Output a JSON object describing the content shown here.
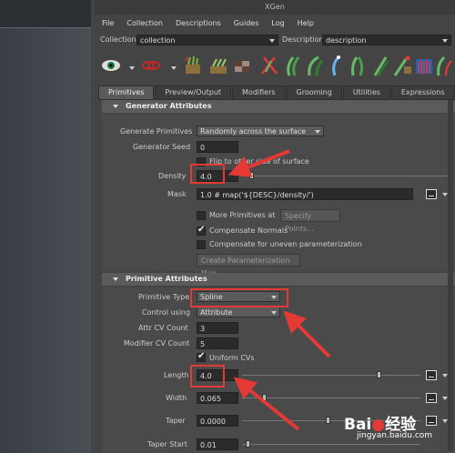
{
  "window": {
    "title": "XGen"
  },
  "menubar": [
    "File",
    "Collection",
    "Descriptions",
    "Guides",
    "Log",
    "Help"
  ],
  "collection_row": {
    "collection_label": "Collection",
    "collection_value": "collection",
    "description_label": "Description",
    "description_value": "description"
  },
  "tabs": [
    "Primitives",
    "Preview/Output",
    "Modifiers",
    "Grooming",
    "Utilities",
    "Expressions"
  ],
  "active_tab": "Primitives",
  "generator": {
    "header": "Generator Attributes",
    "generate_primitives_label": "Generate Primitives",
    "generate_primitives_value": "Randomly across the surface",
    "generator_seed_label": "Generator Seed",
    "generator_seed_value": "0",
    "flip_label": "Flip to other side of surface",
    "density_label": "Density",
    "density_value": "4.0",
    "mask_label": "Mask",
    "mask_value": "1.0 # map('${DESC}/density/')",
    "more_primitives_label": "More Primitives at",
    "specify_points_button": "Specify Points...",
    "compensate_normals_label": "Compensate Normals",
    "compensate_uneven_label": "Compensate for uneven parameterization",
    "create_map_button": "Create Parameterization Map"
  },
  "primitive": {
    "header": "Primitive Attributes",
    "primitive_type_label": "Primitive Type",
    "primitive_type_value": "Spline",
    "control_using_label": "Control using",
    "control_using_value": "Attribute",
    "attr_cv_count_label": "Attr CV Count",
    "attr_cv_count_value": "3",
    "modifier_cv_count_label": "Modifier CV Count",
    "modifier_cv_count_value": "5",
    "uniform_cvs_label": "Uniform CVs",
    "length_label": "Length",
    "length_value": "4.0",
    "width_label": "Width",
    "width_value": "0.065",
    "taper_label": "Taper",
    "taper_value": "0.0000",
    "taper_start_label": "Taper Start",
    "taper_start_value": "0.01"
  },
  "watermark": {
    "brand": "Bai",
    "brand2": "经验",
    "url": "jingyan.baidu.com"
  },
  "colors": {
    "highlight": "#e53935",
    "panel": "#444444",
    "header": "#5b5b5b"
  }
}
